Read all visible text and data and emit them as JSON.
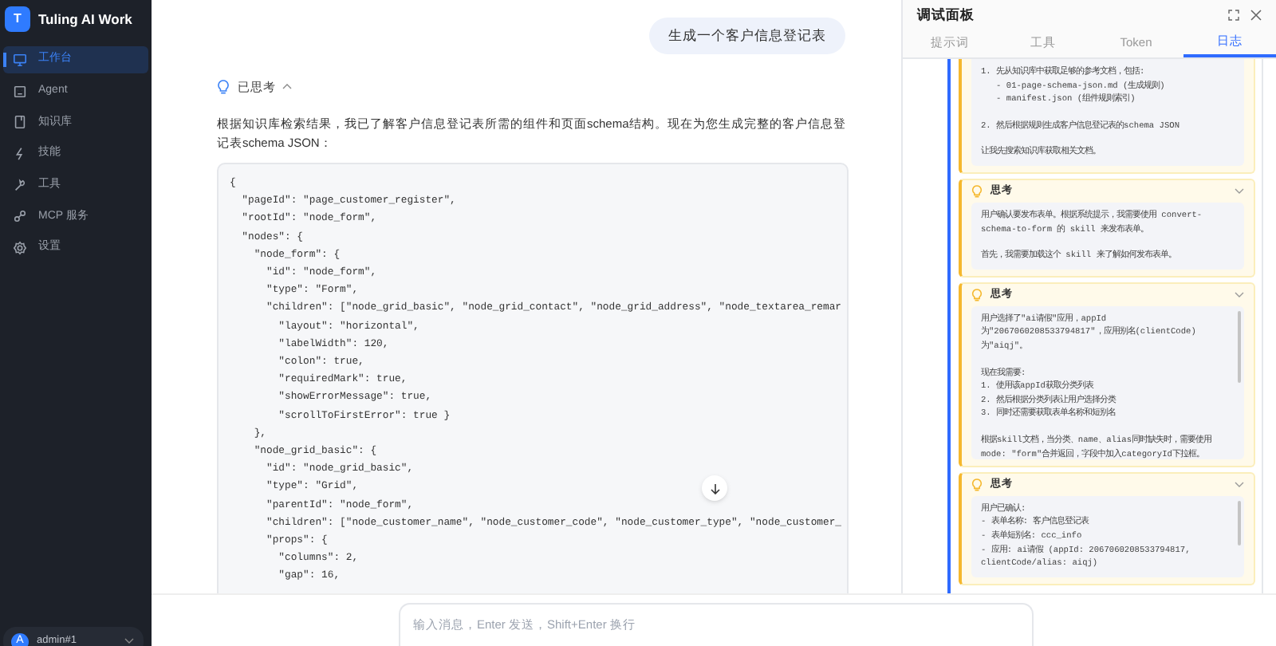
{
  "sidebar": {
    "logo_letter": "T",
    "app_name": "Tuling AI Work",
    "items": [
      {
        "label": "工作台",
        "selected": true
      },
      {
        "label": "Agent",
        "selected": false
      },
      {
        "label": "知识库",
        "selected": false
      },
      {
        "label": "技能",
        "selected": false
      },
      {
        "label": "工具",
        "selected": false
      },
      {
        "label": "MCP 服务",
        "selected": false
      },
      {
        "label": "设置",
        "selected": false
      }
    ],
    "user": {
      "avatar_letter": "A",
      "name": "admin#1"
    }
  },
  "chat": {
    "user_message": "生成一个客户信息登记表",
    "thinking_label": "已思考",
    "answer_intro": "根据知识库检索结果，我已了解客户信息登记表所需的组件和页面schema结构。现在为您生成完整的客户信息登记表schema JSON：",
    "code_lines": [
      "{",
      "  \"pageId\": \"page_customer_register\",",
      "  \"rootId\": \"node_form\",",
      "  \"nodes\": {",
      "    \"node_form\": {",
      "      \"id\": \"node_form\",",
      "      \"type\": \"Form\",",
      "      \"children\": [\"node_grid_basic\", \"node_grid_contact\", \"node_grid_address\", \"node_textarea_remar",
      "        \"layout\": \"horizontal\",",
      "        \"labelWidth\": 120,",
      "        \"colon\": true,",
      "        \"requiredMark\": true,",
      "        \"showErrorMessage\": true,",
      "        \"scrollToFirstError\": true }",
      "    },",
      "    \"node_grid_basic\": {",
      "      \"id\": \"node_grid_basic\",",
      "      \"type\": \"Grid\",",
      "      \"parentId\": \"node_form\",",
      "      \"children\": [\"node_customer_name\", \"node_customer_code\", \"node_customer_type\", \"node_customer_",
      "      \"props\": {",
      "        \"columns\": 2,",
      "        \"gap\": 16,"
    ]
  },
  "input": {
    "placeholder": "输入消息，Enter 发送，Shift+Enter 换行"
  },
  "debug_panel": {
    "title": "调试面板",
    "tabs": [
      {
        "label": "提示词",
        "selected": false
      },
      {
        "label": "工具",
        "selected": false
      },
      {
        "label": "Token",
        "selected": false
      },
      {
        "label": "日志",
        "selected": true
      }
    ],
    "log_cards": [
      {
        "kind": "partial",
        "paragraphs": [
          "1. 先从知识库中获取足够的参考文档，包括:\n   - 01-page-schema-json.md (生成规则)\n   - manifest.json (组件规则索引)",
          "2. 然后根据规则生成客户信息登记表的schema JSON",
          "让我先搜索知识库获取相关文档。"
        ]
      },
      {
        "kind": "thought",
        "title": "思考",
        "scrollbar": false,
        "paragraphs": [
          "用户确认要发布表单。根据系统提示，我需要使用 convert-\nschema-to-form 的 skill 来发布表单。",
          "首先，我需要加载这个 skill 来了解如何发布表单。"
        ]
      },
      {
        "kind": "thought",
        "title": "思考",
        "scrollbar": true,
        "paragraphs": [
          "用户选择了\"ai请假\"应用，appId\n为\"2067060208533794817\"，应用别名(clientCode)\n为\"aiqj\"。",
          "现在我需要:\n1. 使用该appId获取分类列表\n2. 然后根据分类列表让用户选择分类\n3. 同时还需要获取表单名称和短别名",
          "根据skill文档，当分类、name、alias同时缺失时，需要使用\nmode: \"form\"合并返回，字段中加入categoryId下拉框。"
        ]
      },
      {
        "kind": "thought",
        "title": "思考",
        "scrollbar": true,
        "paragraphs": [
          "用户已确认:\n- 表单名称: 客户信息登记表\n- 表单短别名: ccc_info\n- 应用: ai请假 (appId: 2067060208533794817,\nclientCode/alias: aiqj)"
        ]
      }
    ]
  }
}
